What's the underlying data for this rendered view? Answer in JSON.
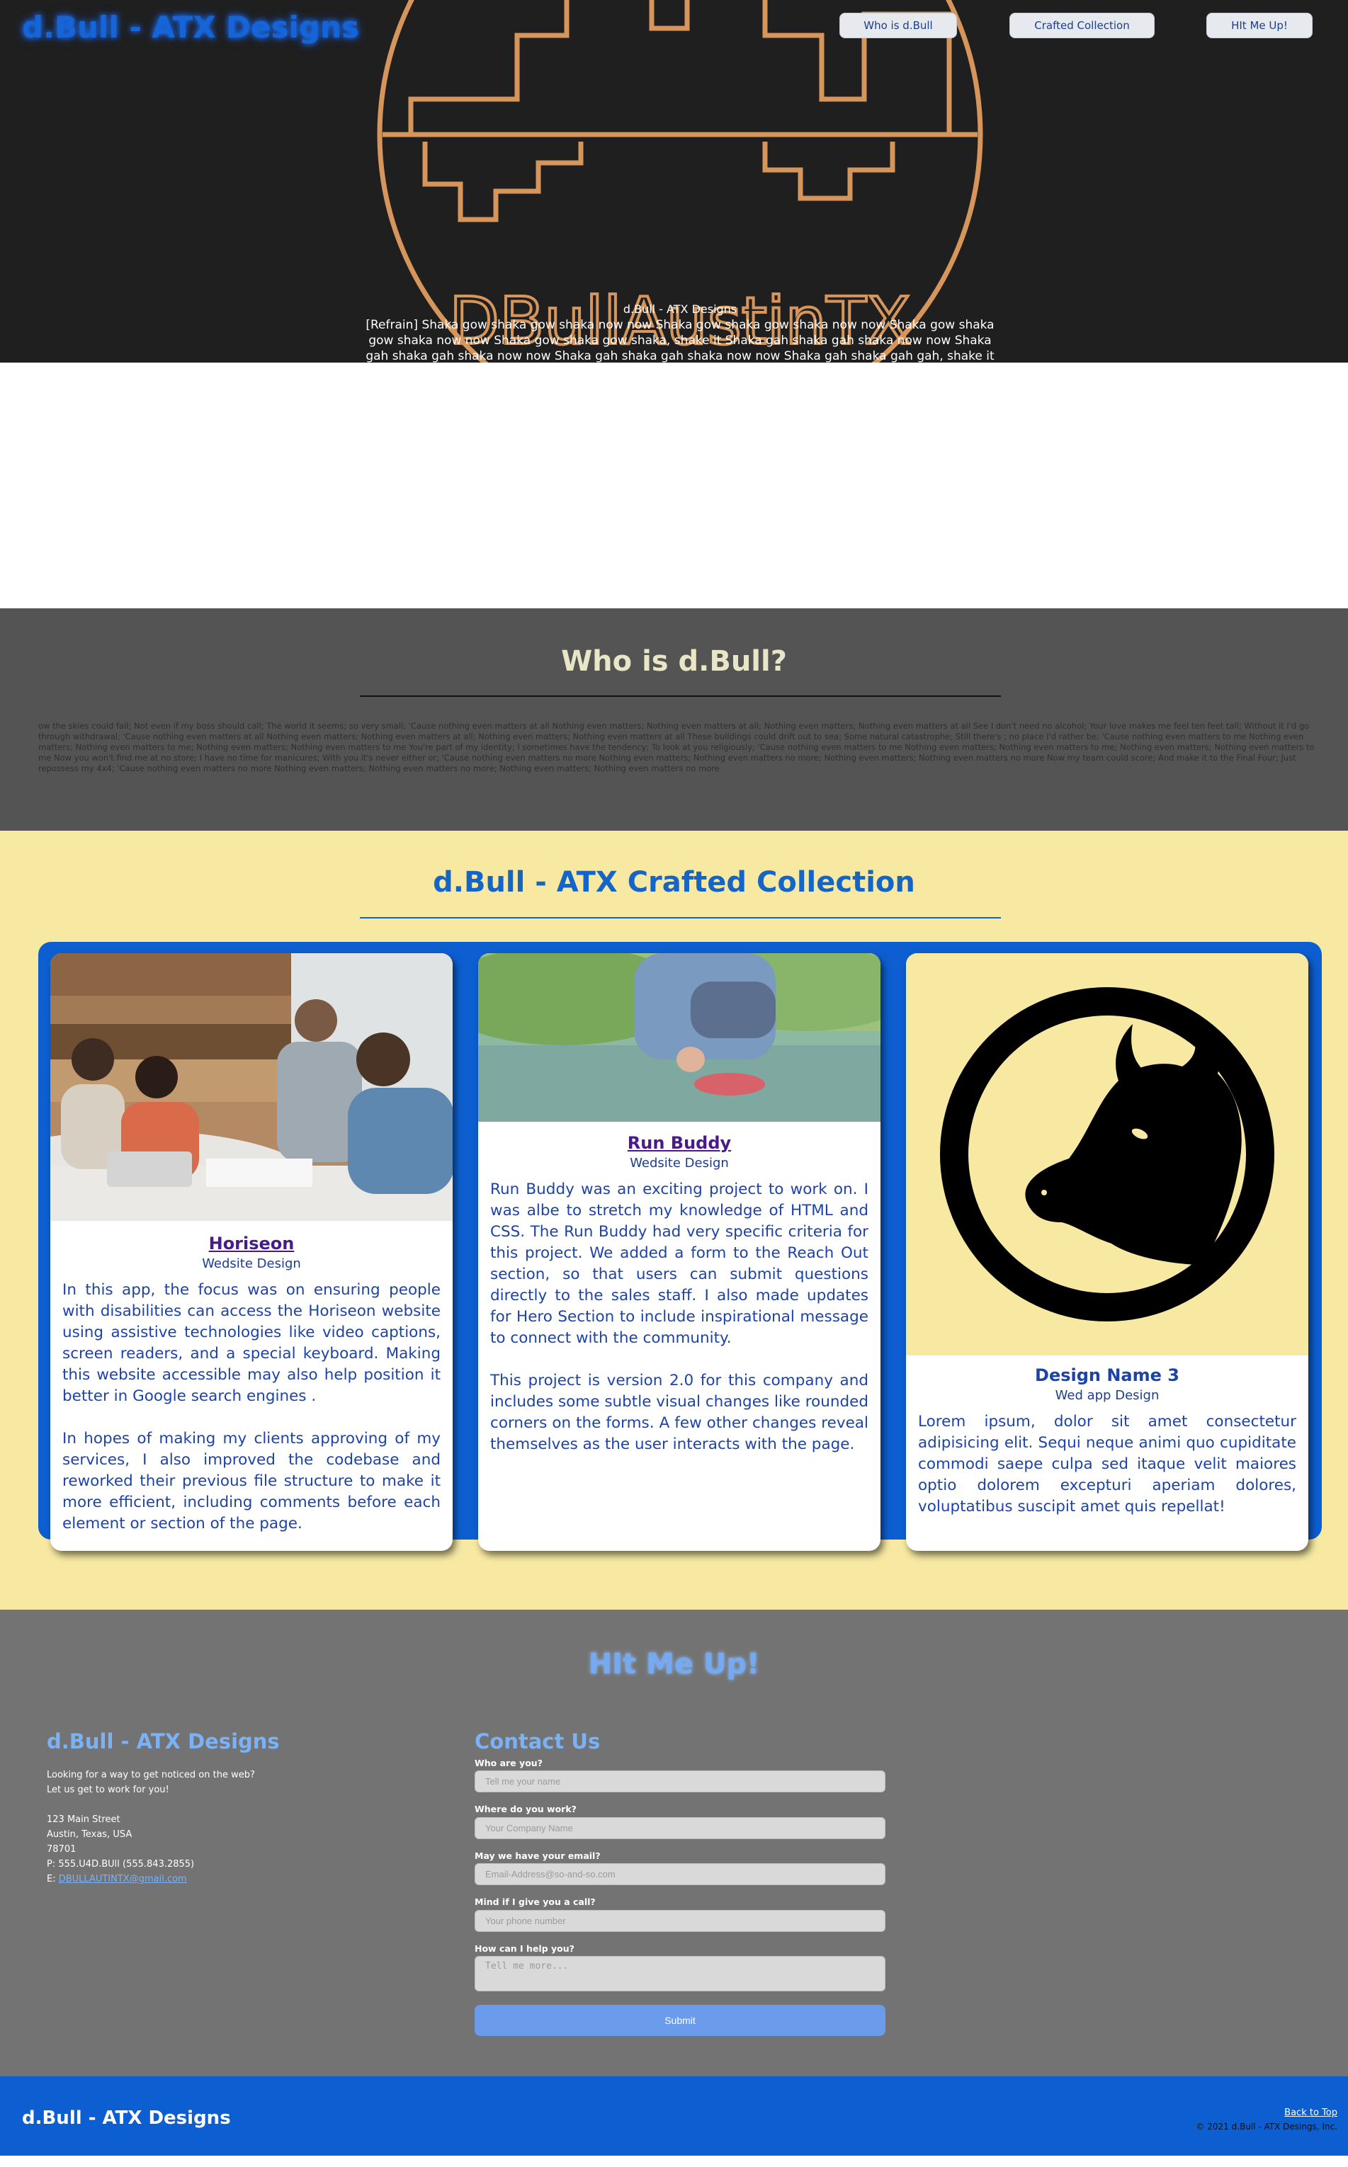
{
  "header": {
    "site_title": "d.Bull - ATX Designs",
    "nav": [
      "Who is d.Bull",
      "Crafted Collection",
      "HIt Me Up!"
    ],
    "logo_text": "DBullAustinTX",
    "caption_title": "d.Bull - ATX Designs",
    "caption_text": "[Refrain] Shaka gow shaka gow shaka now now Shaka gow shaka gow shaka now now Shaka gow shaka gow shaka now now Shaka gow shaka gow shaka, shake it Shaka gah shaka gah shaka now now Shaka gah shaka gah shaka now now Shaka gah shaka gah shaka now now Shaka gah shaka gah gah, shake it"
  },
  "who": {
    "heading": "Who is d.Bull?",
    "text": "ow the skies could fall; Not even if my boss should call; The world it seems; so very small; 'Cause nothing even matters at all Nothing even matters; Nothing even matters at all; Nothing even matters; Nothing even matters at all See I don't need no alcohol; Your love makes me feel ten feet tall; Without it I'd go through withdrawal; 'Cause nothing even matters at all Nothing even matters; Nothing even matters at all; Nothing even matters; Nothing even matters at all These buildings could drift out to sea; Some natural catastrophe; Still there's ; no place I'd rather be; 'Cause nothing even matters to me Nothing even matters; Nothing even matters to me; Nothing even matters; Nothing even matters to me You're part of my identity; I sometimes have the tendency; To look at you religiously; 'Cause nothing even matters to me Nothing even matters; Nothing even matters to me; Nothing even matters; Nothing even matters to me Now you won't find me at no store; I have no time for manicures; With you it's never either or; 'Cause nothing even matters no more Nothing even matters; Nothing even matters no more; Nothing even matters; Nothing even matters no more Now my team could score; And make it to the Final Four; Just repossess my 4x4; 'Cause nothing even matters no more Nothing even matters; Nothing even matters no more; Nothing even matters; Nothing even matters no more"
  },
  "collection": {
    "heading": "d.Bull - ATX Crafted Collection",
    "cards": [
      {
        "title": "Horiseon",
        "subtitle": "Wedsite Design",
        "desc": "In this app, the focus was on ensuring people with disabilities can access the Horiseon website using assistive technologies like video captions, screen readers, and a special keyboard. Making this website accessible may also help position it better in Google search engines .\n\nIn hopes of making my clients approving of my services, I also improved the codebase and reworked their previous file structure to make it more efficient, including comments before each element or section of the page."
      },
      {
        "title": "Run Buddy",
        "subtitle": "Wedsite Design",
        "desc": "Run Buddy was an exciting project to work on. I was albe to stretch my knowledge of HTML and CSS. The Run Buddy had very specific criteria for this project. We added a form to the Reach Out section, so that users can submit questions directly to the sales staff. I also made updates for Hero Section to include inspirational message to connect with the community.\n\nThis project is version 2.0 for this company and includes some subtle visual changes like rounded corners on the forms. A few other changes reveal themselves as the user interacts with the page."
      },
      {
        "title": "Design Name 3",
        "subtitle": "Wed app Design",
        "desc": "Lorem ipsum, dolor sit amet consectetur adipisicing elit. Sequi neque animi quo cupiditate commodi saepe culpa sed itaque velit maiores optio dolorem excepturi aperiam dolores, voluptatibus suscipit amet quis repellat!"
      }
    ]
  },
  "contact": {
    "heading": "HIt Me Up!",
    "biz_title": "d.Bull - ATX Designs",
    "tagline1": "Looking for a way to get noticed on the web?",
    "tagline2": "Let us get to work for you!",
    "street": "123 Main Street",
    "city": "Austin, Texas, USA",
    "zip": "78701",
    "phone": "P: 555.U4D.BUll (555.843.2855)",
    "email_label": "E:",
    "email": "DBULLAUTINTX@gmail.com",
    "form_title": "Contact Us",
    "fields": [
      {
        "label": "Who are you?",
        "placeholder": "Tell me your name"
      },
      {
        "label": "Where do you work?",
        "placeholder": "Your Company Name"
      },
      {
        "label": "May we have your email?",
        "placeholder": "Email-Address@so-and-so.com"
      },
      {
        "label": "Mind if I give you a call?",
        "placeholder": "Your phone number"
      },
      {
        "label": "How can I help you?",
        "placeholder": "Tell me more..."
      }
    ],
    "submit": "Submit"
  },
  "footer": {
    "title": "d.Bull - ATX Designs",
    "back_to_top": "Back to Top",
    "copyright": "© 2021 d.Bull - ATX Desings, Inc."
  },
  "colors": {
    "accent_blue": "#0d5fd1",
    "logo_orange": "#d6955a",
    "collection_bg": "#f7e9a2"
  }
}
